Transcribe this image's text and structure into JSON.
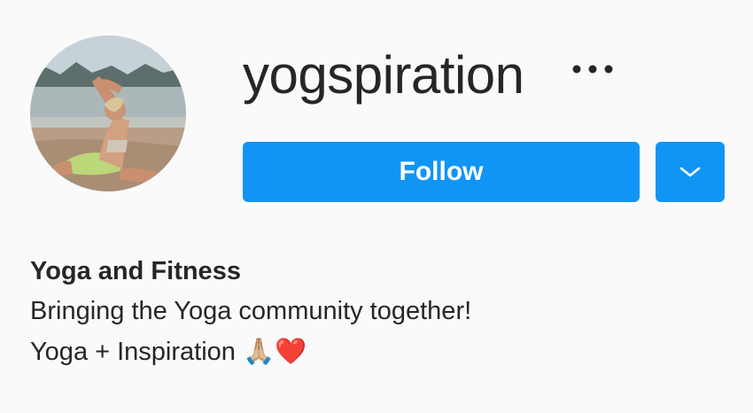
{
  "profile": {
    "username": "yogspiration",
    "avatar_alt": "profile picture",
    "more_icon": "more-horizontal-icon"
  },
  "actions": {
    "follow_label": "Follow",
    "dropdown_icon": "chevron-down-icon",
    "accent_color": "#1195f4"
  },
  "bio": {
    "name": "Yoga and Fitness",
    "lines": [
      "Bringing the Yoga community together!",
      "Yoga + Inspiration 🙏🏼❤️"
    ]
  }
}
